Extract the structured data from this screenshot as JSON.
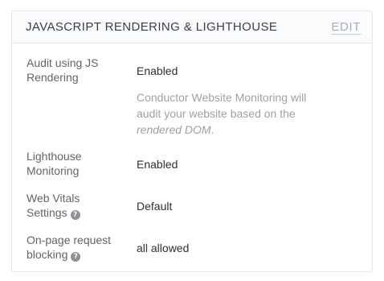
{
  "card": {
    "title": "JAVASCRIPT RENDERING & LIGHTHOUSE",
    "edit_label": "EDIT"
  },
  "rows": [
    {
      "label_line1": "Audit using JS",
      "label_line2": "Rendering",
      "value": "Enabled",
      "note_prefix": "Conductor Website Monitoring will audit your website based on the ",
      "note_em": "rendered DOM",
      "note_suffix": "."
    },
    {
      "label_line1": "Lighthouse",
      "label_line2": "Monitoring",
      "value": "Enabled"
    },
    {
      "label_line1": "Web Vitals",
      "label_line2": "Settings",
      "value": "Default",
      "help_icon": "question-circle-icon"
    },
    {
      "label_line1": "On-page request",
      "label_line2": "blocking",
      "value": "all allowed",
      "help_icon": "question-circle-icon"
    }
  ]
}
